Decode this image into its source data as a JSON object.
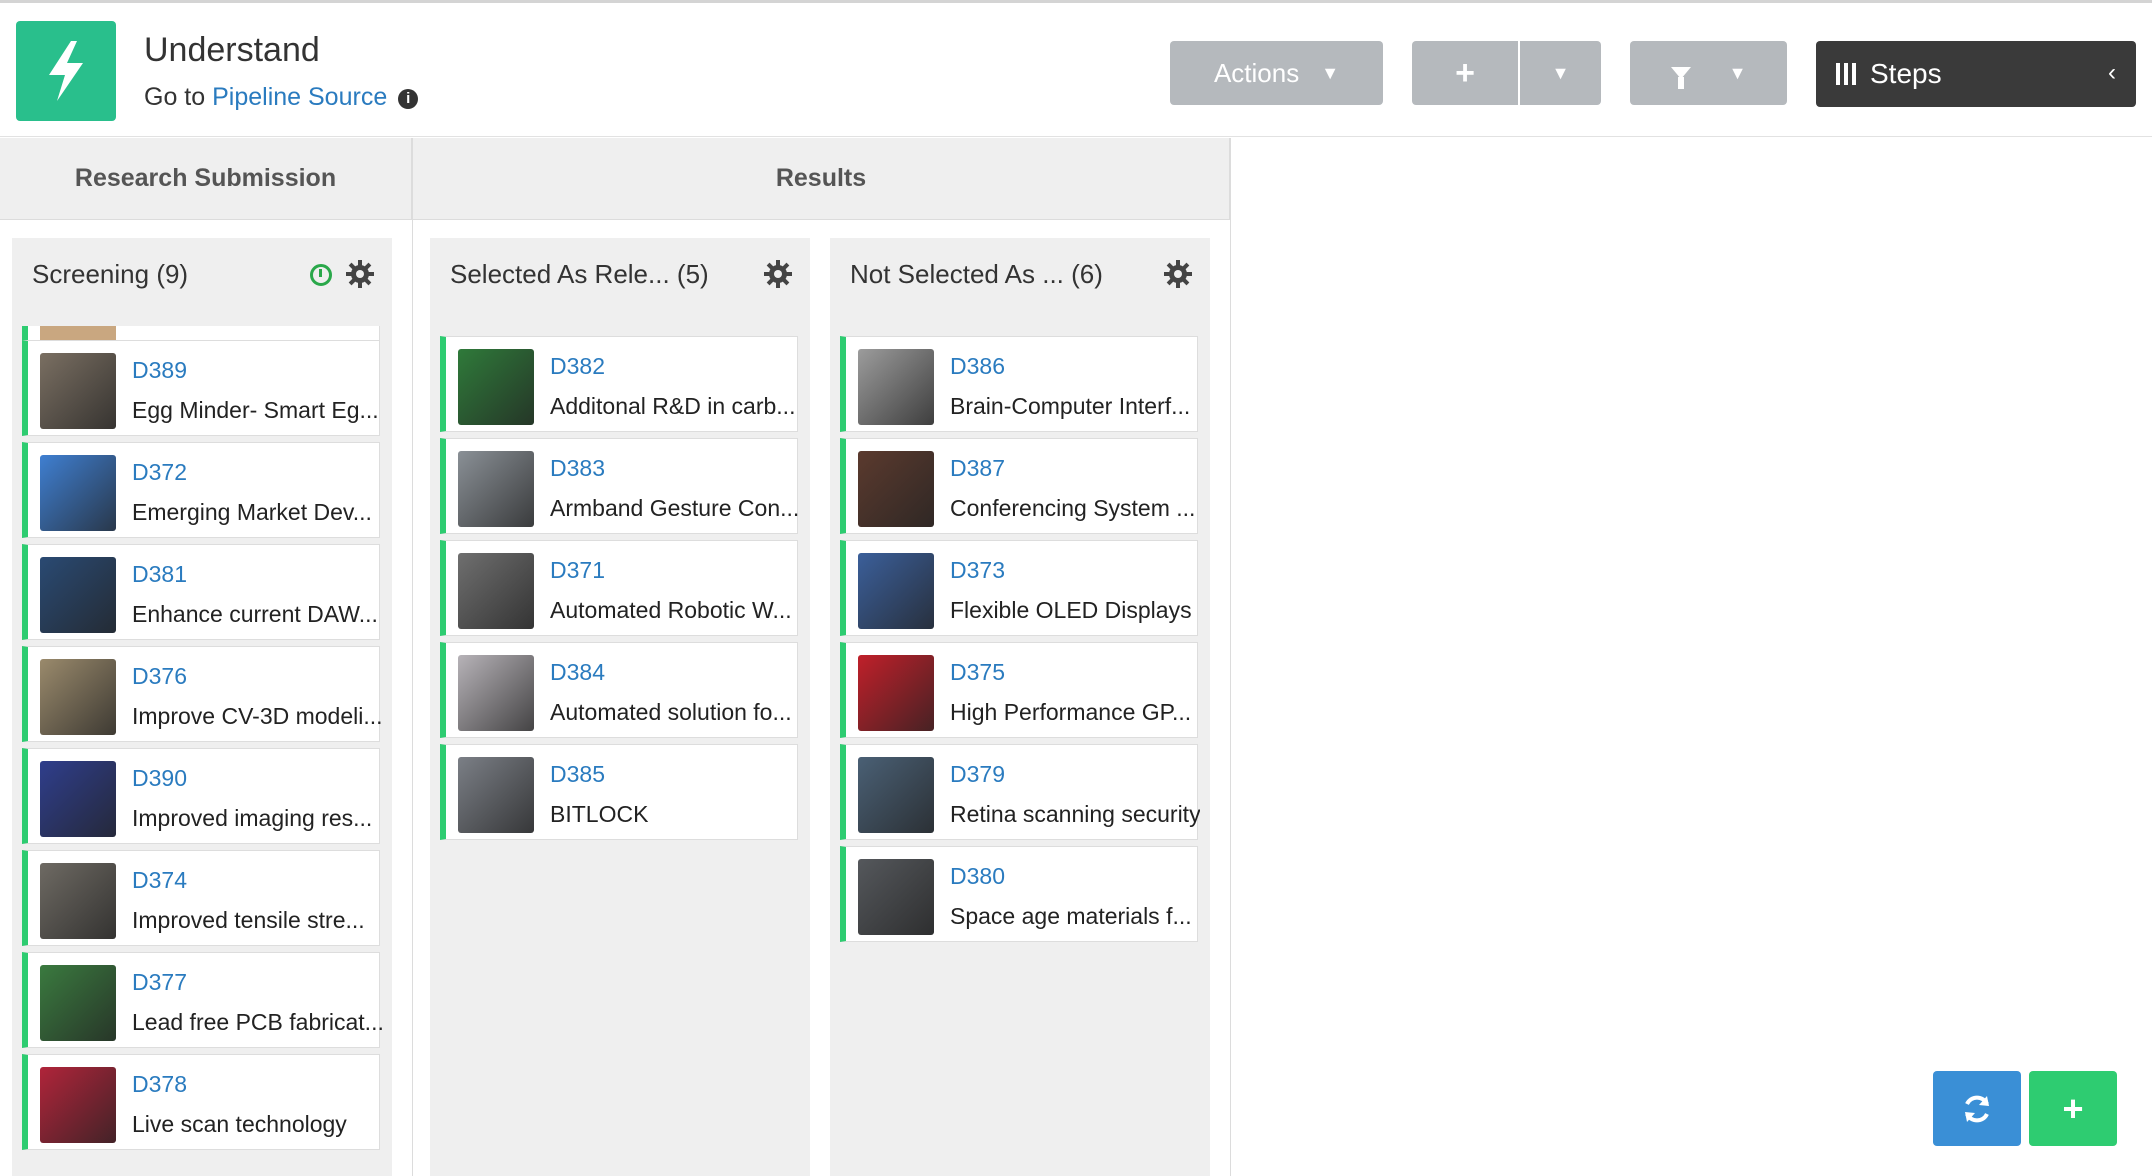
{
  "header": {
    "title": "Understand",
    "goto_prefix": "Go to",
    "goto_link": "Pipeline Source",
    "actions_label": "Actions",
    "steps_label": "Steps"
  },
  "groups": {
    "research": "Research Submission",
    "results": "Results"
  },
  "lanes": [
    {
      "name": "Screening",
      "count": "(9)",
      "cards": [
        {
          "id": "D389",
          "name": "Egg Minder- Smart Eg...",
          "thumb": "#7a6f62"
        },
        {
          "id": "D372",
          "name": "Emerging Market Dev...",
          "thumb": "#3f7fd1"
        },
        {
          "id": "D381",
          "name": "Enhance current DAW...",
          "thumb": "#2a4a73"
        },
        {
          "id": "D376",
          "name": "Improve CV-3D modeli...",
          "thumb": "#9a8a6c"
        },
        {
          "id": "D390",
          "name": "Improved imaging res...",
          "thumb": "#2f3e8c"
        },
        {
          "id": "D374",
          "name": "Improved tensile stre...",
          "thumb": "#6e6a63"
        },
        {
          "id": "D377",
          "name": "Lead free PCB fabricat...",
          "thumb": "#3a7a3f"
        },
        {
          "id": "D378",
          "name": "Live scan technology",
          "thumb": "#b0243a"
        }
      ]
    },
    {
      "name": "Selected As Rele...",
      "count": "(5)",
      "cards": [
        {
          "id": "D382",
          "name": "Additonal R&D in carb...",
          "thumb": "#2f7a3a"
        },
        {
          "id": "D383",
          "name": "Armband Gesture Con...",
          "thumb": "#8a9096"
        },
        {
          "id": "D371",
          "name": "Automated Robotic W...",
          "thumb": "#6f6f6f"
        },
        {
          "id": "D384",
          "name": "Automated solution fo...",
          "thumb": "#b7b3b8"
        },
        {
          "id": "D385",
          "name": "BITLOCK",
          "thumb": "#7b7f86"
        }
      ]
    },
    {
      "name": "Not Selected As ...",
      "count": "(6)",
      "cards": [
        {
          "id": "D386",
          "name": "Brain-Computer Interf...",
          "thumb": "#9c9c9c"
        },
        {
          "id": "D387",
          "name": "Conferencing System ...",
          "thumb": "#5b3a2e"
        },
        {
          "id": "D373",
          "name": "Flexible OLED Displays",
          "thumb": "#3b5f9a"
        },
        {
          "id": "D375",
          "name": "High Performance GP...",
          "thumb": "#c0202a"
        },
        {
          "id": "D379",
          "name": "Retina scanning security",
          "thumb": "#4a6075"
        },
        {
          "id": "D380",
          "name": "Space age materials f...",
          "thumb": "#55585c"
        }
      ]
    }
  ],
  "colors": {
    "accent_green": "#2ecc71",
    "logo_teal": "#29bf8c",
    "link_blue": "#2a7bbf",
    "refresh_blue": "#3a8fd6"
  }
}
